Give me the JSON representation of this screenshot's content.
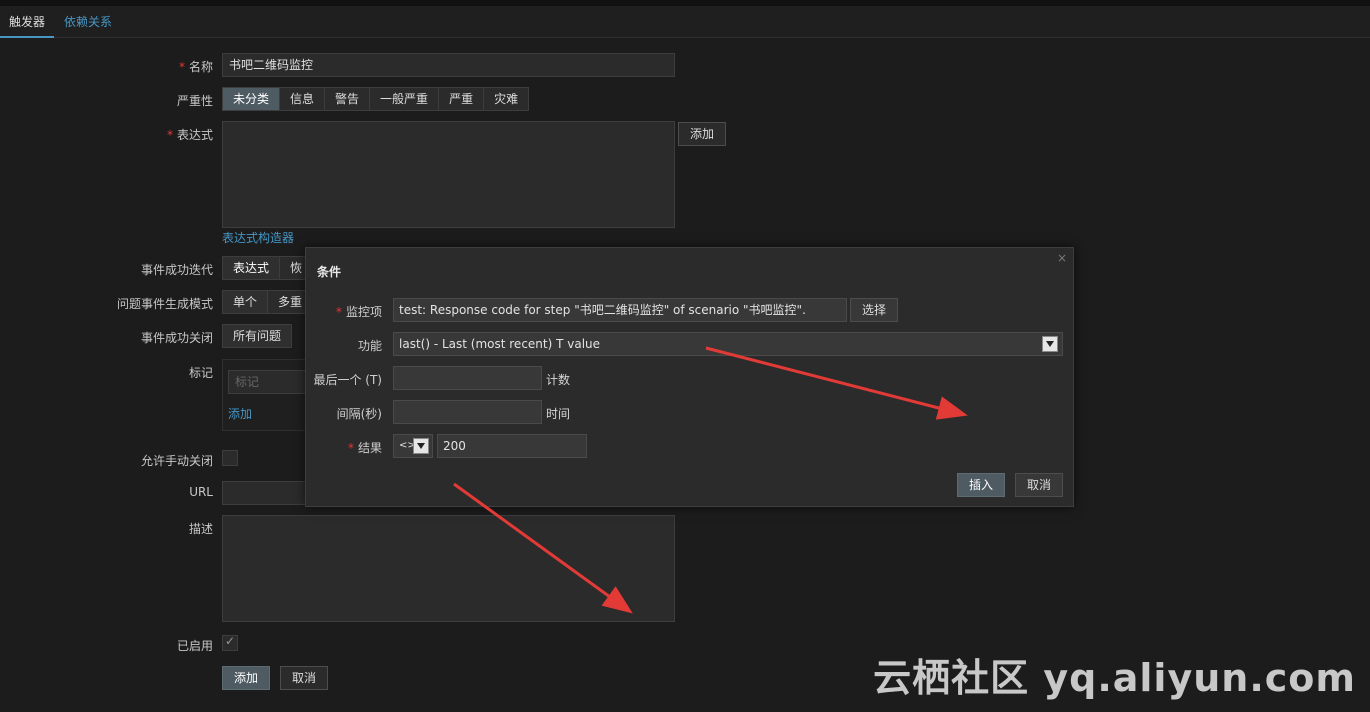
{
  "tabs": {
    "triggers": "触发器",
    "dependencies": "依赖关系"
  },
  "form": {
    "name_label": "名称",
    "name_value": "书吧二维码监控",
    "severity_label": "严重性",
    "severity_options": [
      "未分类",
      "信息",
      "警告",
      "一般严重",
      "严重",
      "灾难"
    ],
    "expression_label": "表达式",
    "expression_add": "添加",
    "expression_builder": "表达式构造器",
    "ok_event_gen_label": "事件成功迭代",
    "ok_event_gen_options": [
      "表达式",
      "恢"
    ],
    "problem_mode_label": "问题事件生成模式",
    "problem_mode_options": [
      "单个",
      "多重"
    ],
    "ok_close_label": "事件成功关闭",
    "ok_close_value": "所有问题",
    "tags_label": "标记",
    "tags_placeholder": "标记",
    "tags_add": "添加",
    "manual_close_label": "允许手动关闭",
    "url_label": "URL",
    "description_label": "描述",
    "enabled_label": "已启用",
    "submit": "添加",
    "cancel": "取消"
  },
  "modal": {
    "title": "条件",
    "close": "×",
    "item_label": "监控项",
    "item_value": "test: Response code for step \"书吧二维码监控\" of scenario \"书吧监控\".",
    "select": "选择",
    "function_label": "功能",
    "function_value": "last() - Last (most recent) T value",
    "last_label": "最后一个 (T)",
    "last_unit": "计数",
    "interval_label": "间隔(秒)",
    "interval_unit": "时间",
    "result_label": "结果",
    "operator": "<>",
    "result_value": "200",
    "insert": "插入",
    "cancel": "取消"
  },
  "watermark": "云栖社区 yq.aliyun.com",
  "colors": {
    "accent": "#4796c4",
    "primary_button": "#4f5b63",
    "arrow": "#e23a36",
    "required": "#e33734"
  }
}
